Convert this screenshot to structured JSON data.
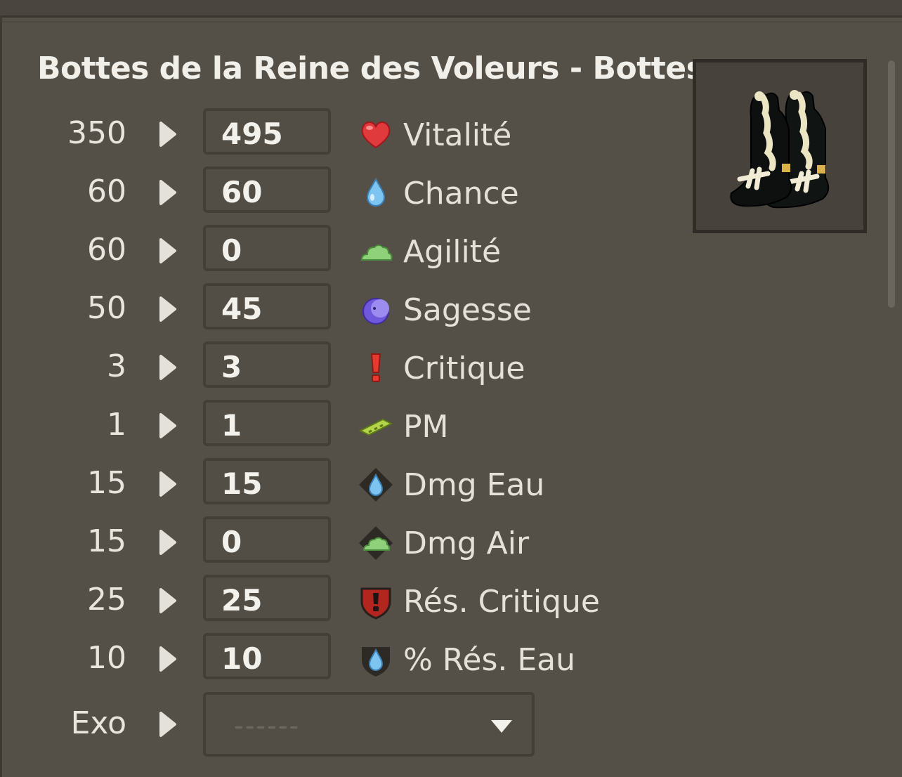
{
  "item": {
    "title": "Bottes de la Reine des Voleurs - Bottes",
    "image_icon": "boots-icon"
  },
  "stats": [
    {
      "base": "350",
      "value": "495",
      "name": "Vitalité",
      "icon": "heart-icon"
    },
    {
      "base": "60",
      "value": "60",
      "name": "Chance",
      "icon": "water-drop-icon"
    },
    {
      "base": "60",
      "value": "0",
      "name": "Agilité",
      "icon": "air-cloud-icon"
    },
    {
      "base": "50",
      "value": "45",
      "name": "Sagesse",
      "icon": "wisdom-moon-icon"
    },
    {
      "base": "3",
      "value": "3",
      "name": "Critique",
      "icon": "critical-exclamation-icon"
    },
    {
      "base": "1",
      "value": "1",
      "name": "PM",
      "icon": "movement-points-icon"
    },
    {
      "base": "15",
      "value": "15",
      "name": "Dmg Eau",
      "icon": "water-damage-icon"
    },
    {
      "base": "15",
      "value": "0",
      "name": "Dmg Air",
      "icon": "air-damage-icon"
    },
    {
      "base": "25",
      "value": "25",
      "name": "Rés. Critique",
      "icon": "critical-resistance-shield-icon"
    },
    {
      "base": "10",
      "value": "10",
      "name": "% Rés. Eau",
      "icon": "water-resistance-shield-icon"
    }
  ],
  "exo": {
    "label": "Exo",
    "placeholder": "------"
  },
  "colors": {
    "panel_bg": "#555047",
    "input_border": "#433f38",
    "text_light": "#f1efea",
    "vitality_red": "#e53a3a",
    "water_blue": "#6db8ea",
    "air_green": "#7dc46a",
    "wisdom_purple": "#6c56d6"
  }
}
